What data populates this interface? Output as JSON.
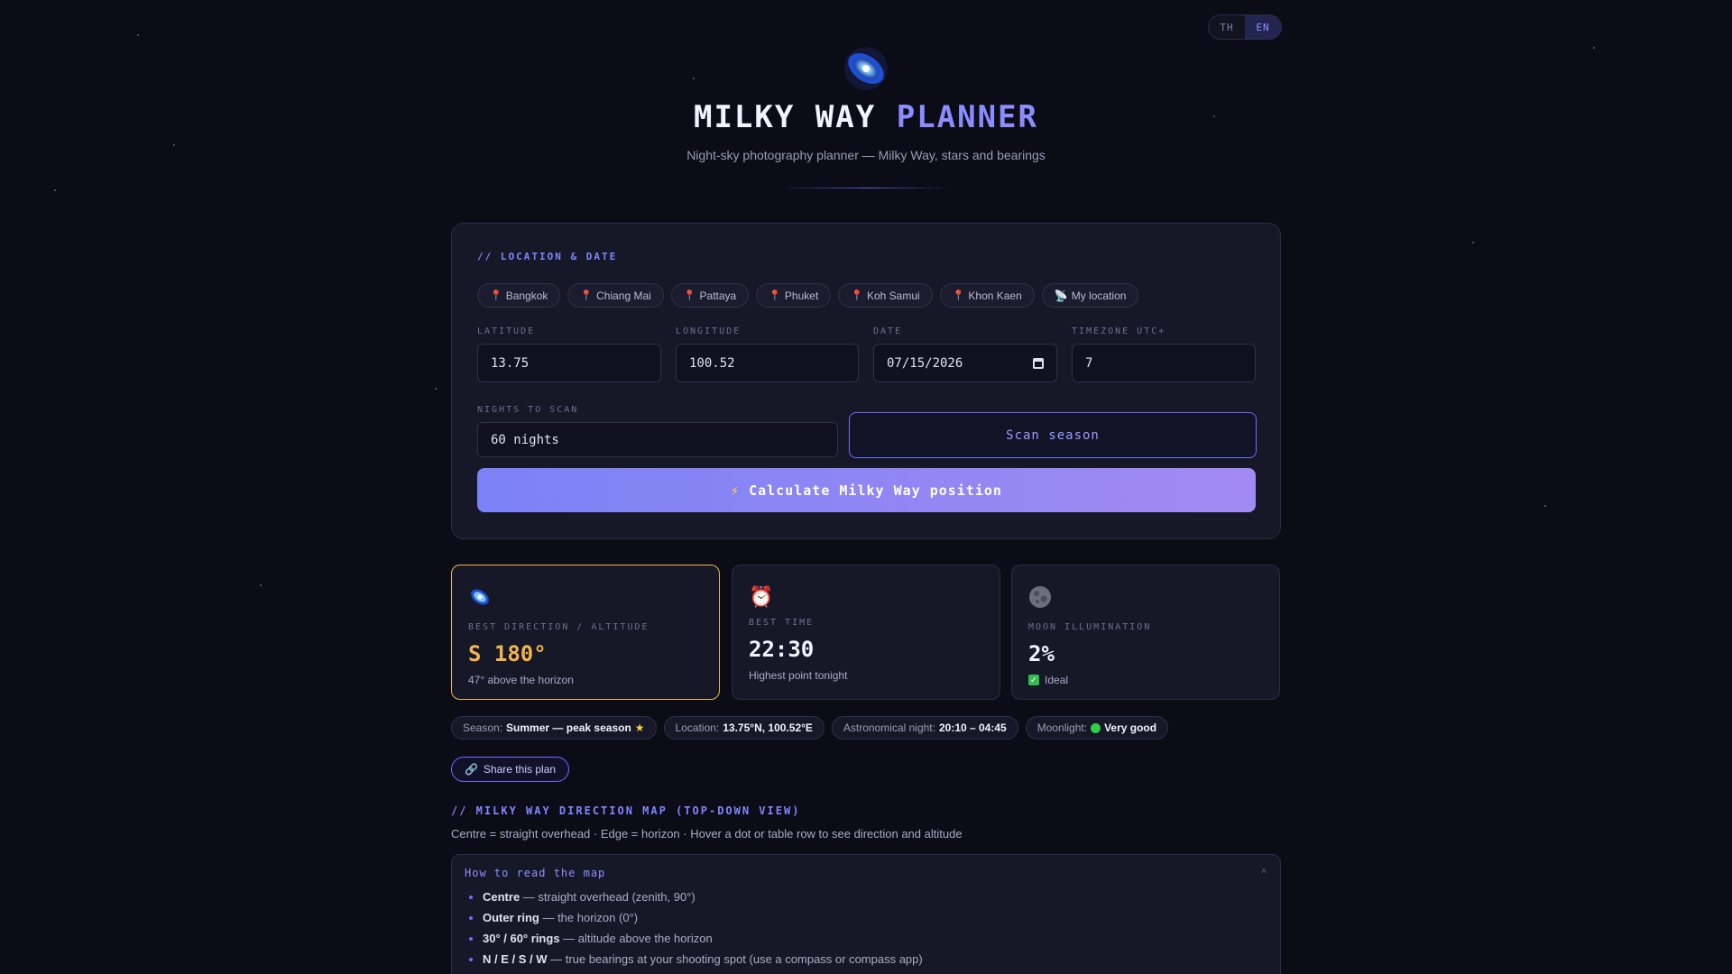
{
  "lang": {
    "th": "TH",
    "en": "EN"
  },
  "hero": {
    "title_main": "MILKY WAY",
    "title_accent": "PLANNER",
    "subtitle": "Night-sky photography planner — Milky Way, stars and bearings"
  },
  "location": {
    "section_label": "// LOCATION & DATE",
    "presets": [
      "Bangkok",
      "Chiang Mai",
      "Pattaya",
      "Phuket",
      "Koh Samui",
      "Khon Kaen"
    ],
    "my_location": "My location",
    "latitude_label": "LATITUDE",
    "latitude_value": "13.75",
    "longitude_label": "LONGITUDE",
    "longitude_value": "100.52",
    "date_label": "DATE",
    "date_value": "07/15/2026",
    "timezone_label": "TIMEZONE UTC+",
    "timezone_value": "7",
    "nights_label": "NIGHTS TO SCAN",
    "nights_value": "60 nights",
    "scan_button": "Scan season",
    "calc_button": "Calculate Milky Way position"
  },
  "stats": {
    "direction": {
      "label": "BEST DIRECTION / ALTITUDE",
      "value": "S 180°",
      "note": "47° above the horizon"
    },
    "time": {
      "label": "BEST TIME",
      "value": "22:30",
      "note": "Highest point tonight"
    },
    "moon": {
      "label": "MOON ILLUMINATION",
      "value": "2%",
      "note": "Ideal"
    }
  },
  "pills": {
    "season_label": "Season:",
    "season_value": "Summer — peak season",
    "location_label": "Location:",
    "location_value": "13.75°N, 100.52°E",
    "night_label": "Astronomical night:",
    "night_value": "20:10 – 04:45",
    "moon_label": "Moonlight:",
    "moon_value": "Very good"
  },
  "share_button": "Share this plan",
  "map": {
    "title": "// MILKY WAY DIRECTION MAP (TOP-DOWN VIEW)",
    "subtitle": "Centre = straight overhead · Edge = horizon · Hover a dot or table row to see direction and altitude",
    "howto_title": "How to read the map",
    "items": [
      {
        "term": "Centre",
        "desc": " — straight overhead (zenith, 90°)"
      },
      {
        "term": "Outer ring",
        "desc": " — the horizon (0°)"
      },
      {
        "term": "30° / 60° rings",
        "desc": " — altitude above the horizon"
      },
      {
        "term": "N / E / S / W",
        "desc": " — true bearings at your shooting spot (use a compass or compass app)"
      }
    ]
  },
  "colors": {
    "accent": "#8b8cff",
    "gold": "#f2b44c",
    "bg": "#0b0c15"
  }
}
